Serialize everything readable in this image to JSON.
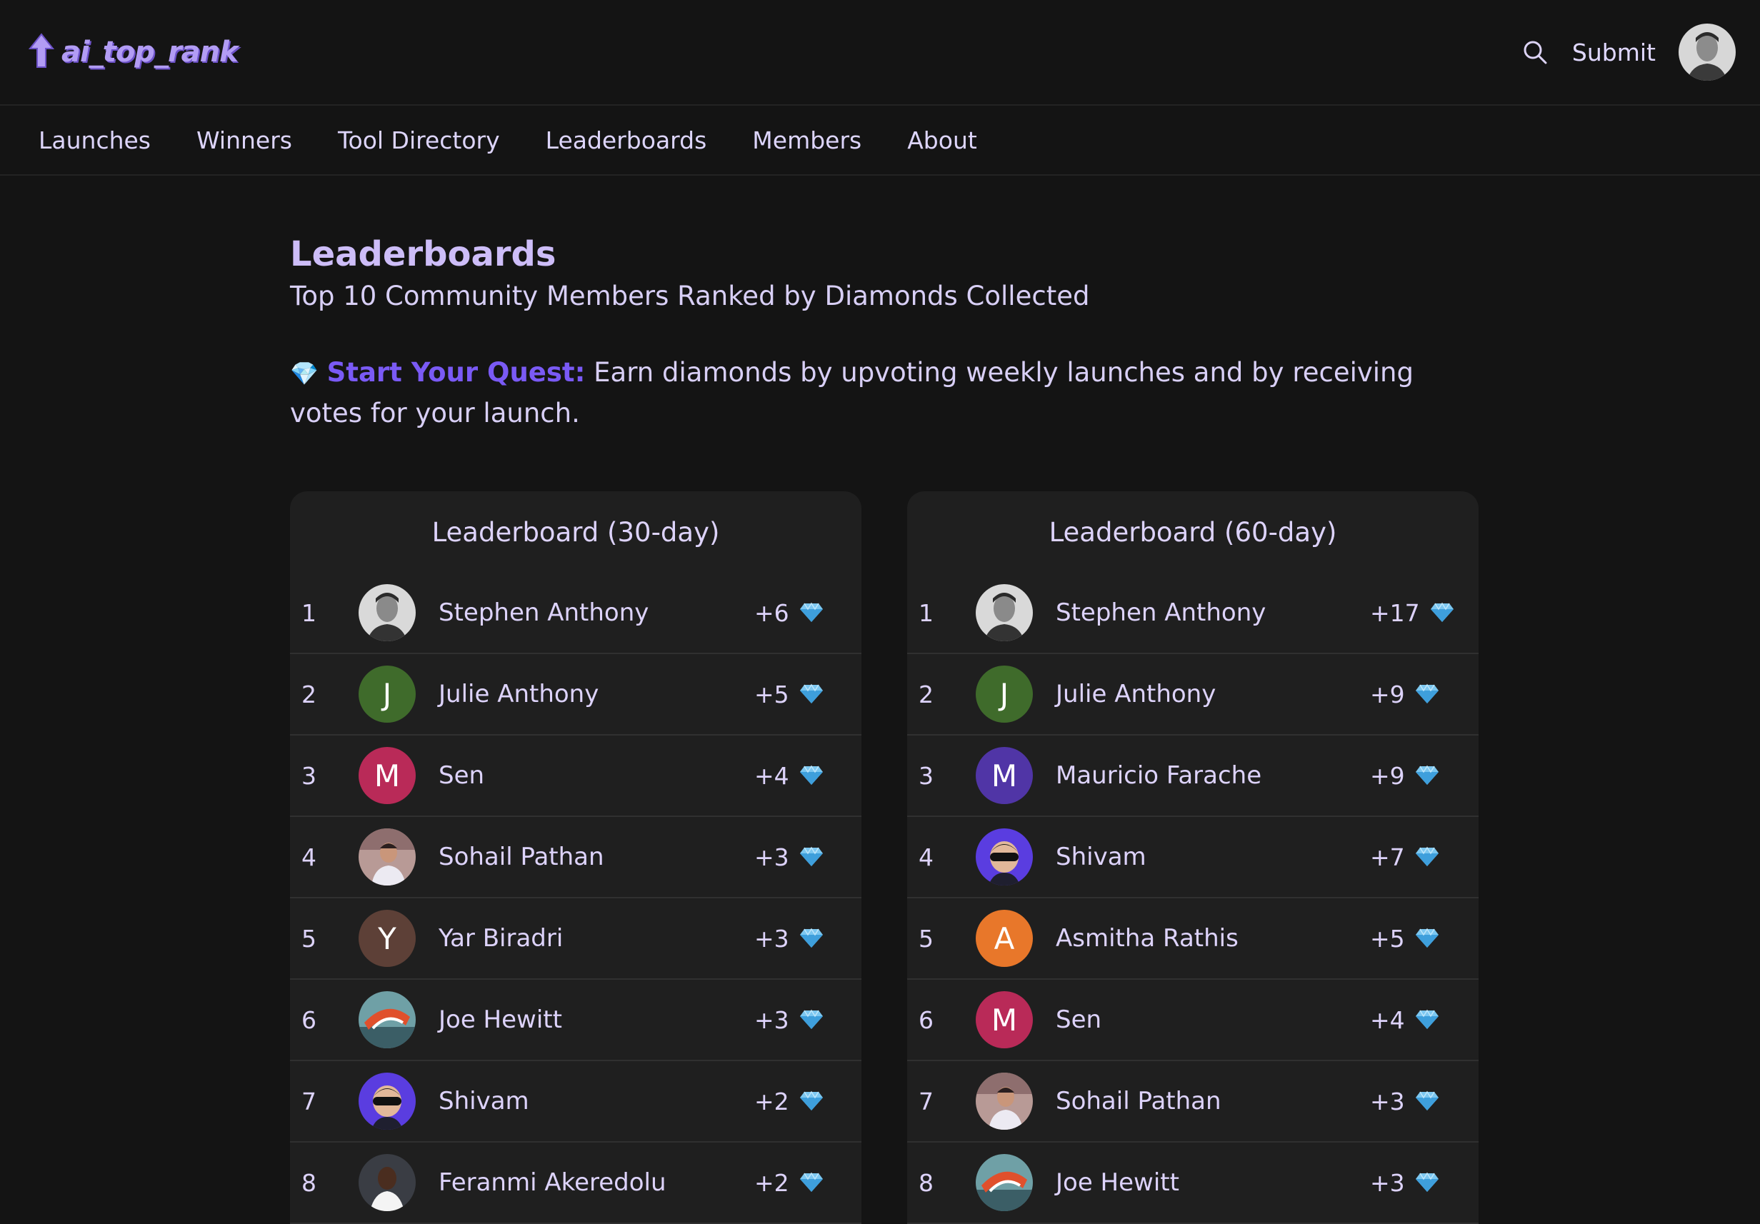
{
  "brand": {
    "name": "ai_top_rank"
  },
  "header": {
    "submit_label": "Submit"
  },
  "nav": {
    "items": [
      "Launches",
      "Winners",
      "Tool Directory",
      "Leaderboards",
      "Members",
      "About"
    ]
  },
  "page": {
    "title": "Leaderboards",
    "subtitle": "Top 10 Community Members Ranked by Diamonds Collected",
    "quest_icon": "💎",
    "quest_label": "Start Your Quest:",
    "quest_text": " Earn diamonds by upvoting weekly launches and by receiving votes for your launch."
  },
  "colors": {
    "accent": "#7a5af5",
    "logo": "#b29cf4",
    "background": "#141414",
    "card": "#1f1f1f"
  },
  "boards": [
    {
      "title": "Leaderboard (30-day)",
      "rows": [
        {
          "rank": "1",
          "name": "Stephen Anthony",
          "score": "+6",
          "avatar": "photo-stephen"
        },
        {
          "rank": "2",
          "name": "Julie Anthony",
          "score": "+5",
          "avatar": "letter",
          "letter": "J",
          "color": "#3f6b2b"
        },
        {
          "rank": "3",
          "name": "Sen",
          "score": "+4",
          "avatar": "letter",
          "letter": "M",
          "color": "#b92a58"
        },
        {
          "rank": "4",
          "name": "Sohail Pathan",
          "score": "+3",
          "avatar": "photo-sohail"
        },
        {
          "rank": "5",
          "name": "Yar Biradri",
          "score": "+3",
          "avatar": "letter",
          "letter": "Y",
          "color": "#5d4037"
        },
        {
          "rank": "6",
          "name": "Joe Hewitt",
          "score": "+3",
          "avatar": "photo-joe"
        },
        {
          "rank": "7",
          "name": "Shivam",
          "score": "+2",
          "avatar": "photo-shivam"
        },
        {
          "rank": "8",
          "name": "Feranmi Akeredolu",
          "score": "+2",
          "avatar": "photo-feranmi"
        }
      ]
    },
    {
      "title": "Leaderboard (60-day)",
      "rows": [
        {
          "rank": "1",
          "name": "Stephen Anthony",
          "score": "+17",
          "avatar": "photo-stephen"
        },
        {
          "rank": "2",
          "name": "Julie Anthony",
          "score": "+9",
          "avatar": "letter",
          "letter": "J",
          "color": "#3f6b2b"
        },
        {
          "rank": "3",
          "name": "Mauricio Farache",
          "score": "+9",
          "avatar": "letter",
          "letter": "M",
          "color": "#5035a6"
        },
        {
          "rank": "4",
          "name": "Shivam",
          "score": "+7",
          "avatar": "photo-shivam"
        },
        {
          "rank": "5",
          "name": "Asmitha Rathis",
          "score": "+5",
          "avatar": "letter",
          "letter": "A",
          "color": "#e8772a"
        },
        {
          "rank": "6",
          "name": "Sen",
          "score": "+4",
          "avatar": "letter",
          "letter": "M",
          "color": "#b92a58"
        },
        {
          "rank": "7",
          "name": "Sohail Pathan",
          "score": "+3",
          "avatar": "photo-sohail"
        },
        {
          "rank": "8",
          "name": "Joe Hewitt",
          "score": "+3",
          "avatar": "photo-joe"
        }
      ]
    }
  ]
}
